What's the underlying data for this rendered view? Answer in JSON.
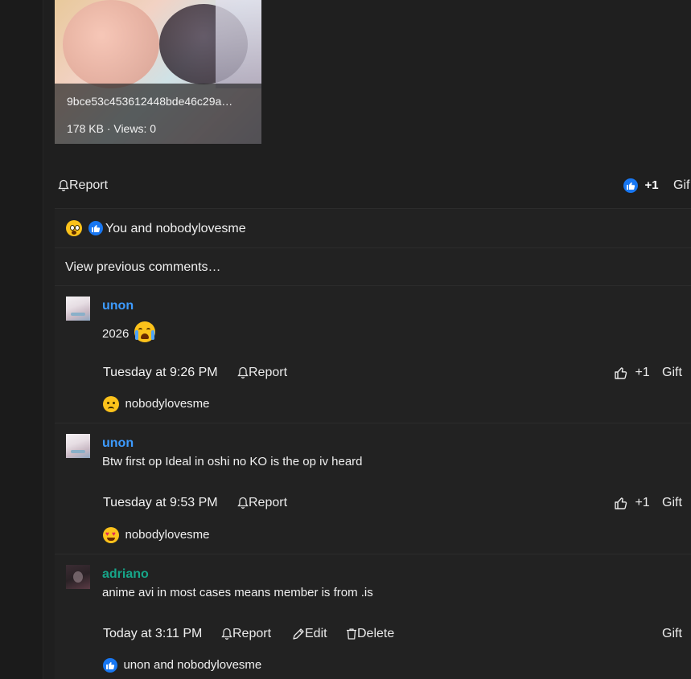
{
  "attachment": {
    "filename": "9bce53c453612448bde46c29a…",
    "meta": "178 KB · Views: 0"
  },
  "post_actions": {
    "report_label": "Report",
    "like_count": "+1",
    "gift_label": "Gif"
  },
  "reactions_summary": {
    "text": "You and nobodylovesme"
  },
  "view_previous": "View previous comments…",
  "comments": [
    {
      "author": "unon",
      "text": "2026",
      "time": "Tuesday at 9:26 PM",
      "report_label": "Report",
      "like_count": "+1",
      "gift_label": "Gift",
      "reaction_user": "nobodylovesme"
    },
    {
      "author": "unon",
      "text": "Btw first op Ideal in oshi no KO is the op iv heard",
      "time": "Tuesday at 9:53 PM",
      "report_label": "Report",
      "like_count": "+1",
      "gift_label": "Gift",
      "reaction_user": "nobodylovesme"
    },
    {
      "author": "adriano",
      "text": "anime avi in most cases means member is from .is",
      "time": "Today at 3:11 PM",
      "report_label": "Report",
      "edit_label": "Edit",
      "delete_label": "Delete",
      "gift_label": "Gift",
      "reaction_user": "unon and nobodylovesme"
    }
  ],
  "colors": {
    "background": "#1f1f1f",
    "author_link": "#3d9bff",
    "author_staff": "#17a589",
    "like_blue": "#1877f2"
  }
}
